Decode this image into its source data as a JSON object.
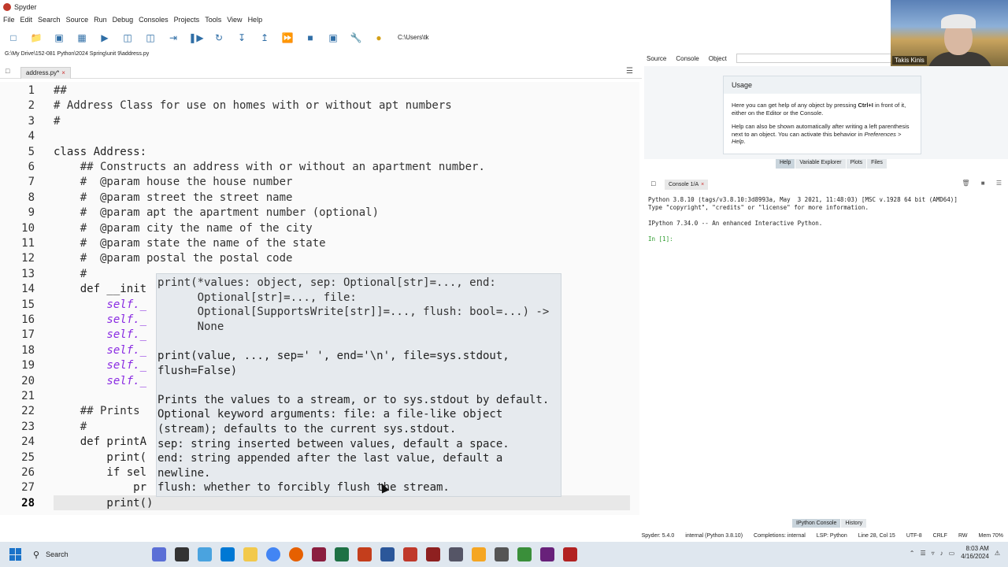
{
  "window": {
    "title": "Spyder"
  },
  "menu": [
    "File",
    "Edit",
    "Search",
    "Source",
    "Run",
    "Debug",
    "Consoles",
    "Projects",
    "Tools",
    "View",
    "Help"
  ],
  "toolbar": {
    "working_dir": "C:\\Users\\tk"
  },
  "path": "G:\\My Drive\\152-081 Python\\2024 Spring\\unit 9\\address.py",
  "editor": {
    "tab_label": "address.py*",
    "lines": [
      "##",
      "# Address Class for use on homes with or without apt numbers",
      "#",
      "",
      "class Address:",
      "    ## Constructs an address with or without an apartment number.",
      "    #  @param house the house number",
      "    #  @param street the street name",
      "    #  @param apt the apartment number (optional)",
      "    #  @param city the name of the city",
      "    #  @param state the name of the state",
      "    #  @param postal the postal code",
      "    #",
      "    def __init",
      "        self._",
      "        self._",
      "        self._",
      "        self._",
      "        self._",
      "        self._",
      "",
      "    ## Prints",
      "    #",
      "    def printA",
      "        print(",
      "        if sel",
      "            pr",
      "        print()"
    ],
    "line_numbers": [
      "1",
      "2",
      "3",
      "4",
      "5",
      "6",
      "7",
      "8",
      "9",
      "10",
      "11",
      "12",
      "13",
      "14",
      "15",
      "16",
      "17",
      "18",
      "19",
      "20",
      "21",
      "22",
      "23",
      "24",
      "25",
      "26",
      "27",
      "28"
    ]
  },
  "calltip": {
    "lines": [
      "print(*values: object, sep: Optional[str]=..., end:",
      "      Optional[str]=..., file:",
      "      Optional[SupportsWrite[str]]=..., flush: bool=...) ->",
      "      None",
      "",
      "print(value, ..., sep=' ', end='\\n', file=sys.stdout,",
      "flush=False)",
      "",
      "Prints the values to a stream, or to sys.stdout by default.",
      "Optional keyword arguments: file: a file-like object",
      "(stream); defaults to the current sys.stdout.",
      "sep: string inserted between values, default a space.",
      "end: string appended after the last value, default a",
      "newline.",
      "flush: whether to forcibly flush the stream."
    ]
  },
  "help": {
    "tabs": [
      "Source",
      "Console",
      "Object"
    ],
    "usage_title": "Usage",
    "usage_p1a": "Here you can get help of any object by pressing ",
    "usage_p1b": "Ctrl+I",
    "usage_p1c": " in front of it, either on the Editor or the Console.",
    "usage_p2a": "Help can also be shown automatically after writing a left parenthesis next to an object. You can activate this behavior in ",
    "usage_p2b": "Preferences > Help",
    "usage_p2c": ".",
    "bottom_tabs": [
      "Help",
      "Variable Explorer",
      "Plots",
      "Files"
    ]
  },
  "console": {
    "tab_label": "Console 1/A",
    "lines": [
      "Python 3.8.10 (tags/v3.8.10:3d8993a, May  3 2021, 11:48:03) [MSC v.1928 64 bit (AMD64)]",
      "Type \"copyright\", \"credits\" or \"license\" for more information.",
      "",
      "IPython 7.34.0 -- An enhanced Interactive Python.",
      "",
      "In [1]:"
    ],
    "bottom_tabs": [
      "IPython Console",
      "History"
    ]
  },
  "status": {
    "spyder": "Spyder: 5.4.0",
    "interpreter": "internal (Python 3.8.10)",
    "completions": "Completions: internal",
    "lsp": "LSP: Python",
    "position": "Line 28, Col 15",
    "encoding": "UTF-8",
    "eol": "CRLF",
    "rw": "RW",
    "mem": "Mem 70%"
  },
  "taskbar": {
    "search": "Search",
    "time": "8:03 AM",
    "date": "4/16/2024"
  },
  "webcam": {
    "name": "Takis Kinis"
  }
}
